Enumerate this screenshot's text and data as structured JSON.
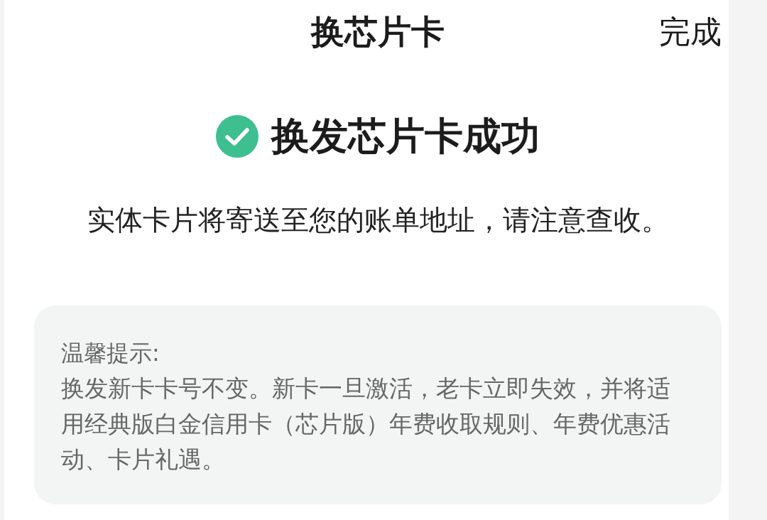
{
  "header": {
    "title": "换芯片卡",
    "done_button": "完成"
  },
  "result": {
    "success": true,
    "title": "换发芯片卡成功",
    "message": "实体卡片将寄送至您的账单地址，请注意查收。"
  },
  "tip": {
    "title": "温馨提示:",
    "body": "换发新卡卡号不变。新卡一旦激活，老卡立即失效，并将适用经典版白金信用卡（芯片版）年费收取规则、年费优惠活动、卡片礼遇。"
  }
}
